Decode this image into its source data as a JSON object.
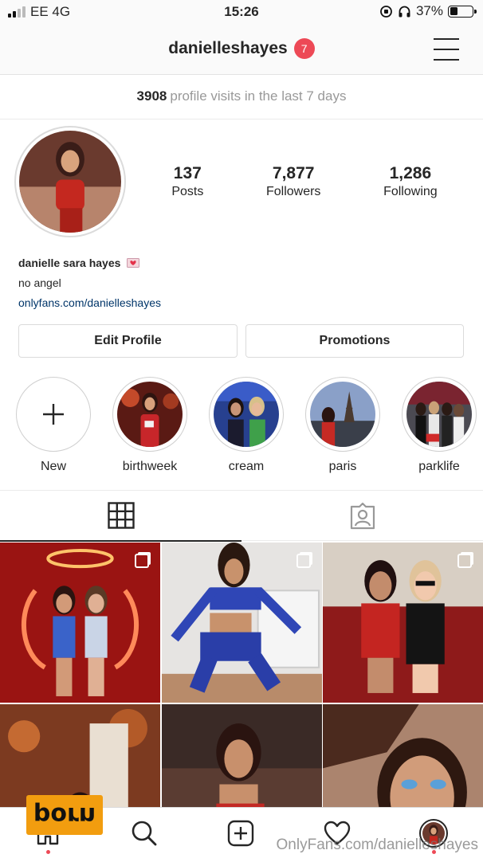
{
  "status_bar": {
    "carrier": "EE 4G",
    "time": "15:26",
    "battery": "37%",
    "battery_level": 0.37
  },
  "header": {
    "username": "danielleshayes",
    "notification_count": "7"
  },
  "visits": {
    "count": "3908",
    "text": "profile visits in the last 7 days"
  },
  "stats": [
    {
      "value": "137",
      "label": "Posts"
    },
    {
      "value": "7,877",
      "label": "Followers"
    },
    {
      "value": "1,286",
      "label": "Following"
    }
  ],
  "bio": {
    "name": "danielle sara hayes",
    "line": "no angel",
    "link": "onlyfans.com/danielleshayes"
  },
  "buttons": {
    "edit_profile": "Edit Profile",
    "promotions": "Promotions"
  },
  "highlights": [
    {
      "label": "New",
      "icon": "plus-icon"
    },
    {
      "label": "birthweek"
    },
    {
      "label": "cream"
    },
    {
      "label": "paris"
    },
    {
      "label": "parklife"
    }
  ],
  "tabs": [
    {
      "icon": "grid-icon",
      "active": true
    },
    {
      "icon": "tagged-icon",
      "active": false
    }
  ],
  "bottom_nav": [
    {
      "icon": "home-icon"
    },
    {
      "icon": "search-icon"
    },
    {
      "icon": "new-post-icon"
    },
    {
      "icon": "heart-icon"
    },
    {
      "icon": "profile-avatar-icon"
    }
  ],
  "watermarks": {
    "badge": "porn",
    "text": "OnlyFans.com/danielleshayes"
  },
  "colors": {
    "badge_red": "#ed4956",
    "link_blue": "#003569",
    "watermark_orange": "#f29d0f"
  }
}
